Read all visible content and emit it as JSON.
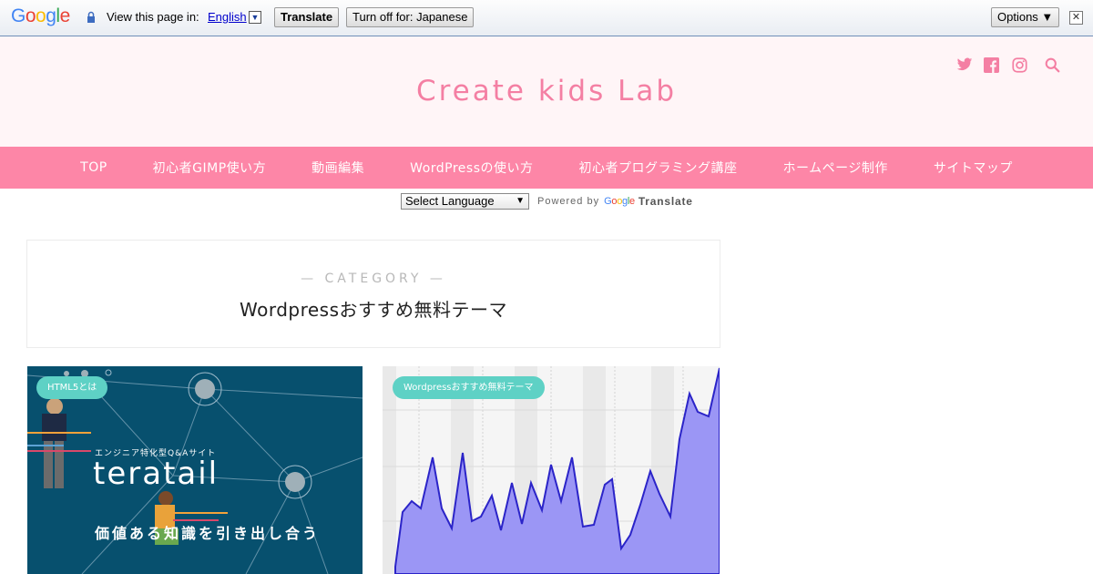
{
  "translate_bar": {
    "logo": "Google",
    "view_text": "View this page in:",
    "language": "English",
    "language_arrow": "▼",
    "translate_button": "Translate",
    "turn_off_button": "Turn off for: Japanese",
    "options_button": "Options ▼",
    "close": "✕"
  },
  "site": {
    "title": "Create kids Lab",
    "social_icons": [
      "twitter-icon",
      "facebook-icon",
      "instagram-icon",
      "search-icon"
    ],
    "accent_color": "#fd86a7"
  },
  "nav": {
    "items": [
      "TOP",
      "初心者GIMP使い方",
      "動画編集",
      "WordPressの使い方",
      "初心者プログラミング講座",
      "ホームページ制作",
      "サイトマップ"
    ]
  },
  "language_widget": {
    "select_label": "Select Language",
    "arrow": "▼",
    "powered_by": "Powered by",
    "google": "Google",
    "translate": "Translate"
  },
  "category": {
    "label": "— CATEGORY —",
    "title": "Wordpressおすすめ無料テーマ"
  },
  "cards": [
    {
      "badge": "HTML5とは",
      "image_tagline": "エンジニア特化型Q&Aサイト",
      "image_brand": "teratail",
      "image_catch": "価値ある知識を引き出し合う"
    },
    {
      "badge": "Wordpressおすすめ無料テーマ"
    }
  ]
}
